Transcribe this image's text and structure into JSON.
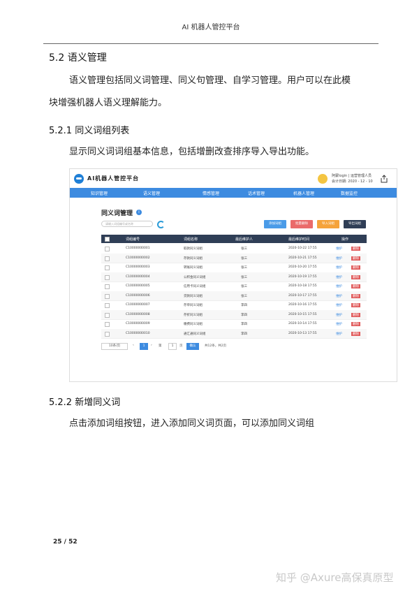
{
  "doc": {
    "header": "AI 机器人管控平台",
    "section_5_2": "5.2  语义管理",
    "para1_line1": "语义管理包括同义词管理、同义句管理、自学习管理。用户可以在此模",
    "para1_line2": "块增强机器人语义理解能力。",
    "section_5_2_1": "5.2.1  同义词组列表",
    "para2": "显示同义词词组基本信息，包括增删改查排序导入导出功能。",
    "section_5_2_2": "5.2.2  新增同义词",
    "para3": "点击添加词组按钮，进入添加同义词页面，可以添加同义词组",
    "page_number": "25 / 52",
    "watermark": "知乎 @Axure高保真原型"
  },
  "screenshot": {
    "app_title": "AI机器人管控平台",
    "user_line1": "阿蒙login | 运营管理人员",
    "user_line2": "会计日期: 2020 - 12 - 10",
    "nav": [
      "知识管理",
      "语义管理",
      "情感管理",
      "话术管理",
      "机器人管理",
      "数据监控"
    ],
    "page_title": "同义词管理",
    "search_placeholder": "请输入词组编号或名称",
    "buttons": {
      "add": "添加词组",
      "batch_delete": "批量删除",
      "import": "导入词组",
      "export": "导出词组"
    },
    "colors": {
      "add": "#4a9be8",
      "batch_delete": "#ea6a6a",
      "import": "#f5a33b",
      "export": "#2f3e56"
    },
    "columns": [
      "词组编号",
      "词组名称",
      "最后维护人",
      "最后维护时间",
      "操作"
    ],
    "rows": [
      {
        "id": "C10000000001",
        "name": "取款同义词组",
        "maintainer": "张三",
        "time": "2020-10-22 17:55",
        "edit": "维护",
        "del": "删除"
      },
      {
        "id": "C10000000002",
        "name": "存款同义词组",
        "maintainer": "张三",
        "time": "2020-10-21 17:55",
        "edit": "维护",
        "del": "删除"
      },
      {
        "id": "C10000000003",
        "name": "转账同义词组",
        "maintainer": "张三",
        "time": "2020-10-20 17:55",
        "edit": "维护",
        "del": "删除"
      },
      {
        "id": "C10000000004",
        "name": "公积金同义词组",
        "maintainer": "张三",
        "time": "2020-10-19 17:55",
        "edit": "维护",
        "del": "删除"
      },
      {
        "id": "C10000000005",
        "name": "信用卡同义词组",
        "maintainer": "张三",
        "time": "2020-10-18 17:55",
        "edit": "维护",
        "del": "删除"
      },
      {
        "id": "C10000000006",
        "name": "贷款同义词组",
        "maintainer": "张三",
        "time": "2020-10-17 17:55",
        "edit": "维护",
        "del": "删除"
      },
      {
        "id": "C10000000007",
        "name": "存单同义词组",
        "maintainer": "李四",
        "time": "2020-10-16 17:55",
        "edit": "维护",
        "del": "删除"
      },
      {
        "id": "C10000000008",
        "name": "存折同义词组",
        "maintainer": "李四",
        "time": "2020-10-15 17:55",
        "edit": "维护",
        "del": "删除"
      },
      {
        "id": "C10000000009",
        "name": "缴费同义词组",
        "maintainer": "李四",
        "time": "2020-10-14 17:55",
        "edit": "维护",
        "del": "删除"
      },
      {
        "id": "C10000000010",
        "name": "通汇通同义词组",
        "maintainer": "李四",
        "time": "2020-10-13 17:55",
        "edit": "维护",
        "del": "删除"
      }
    ],
    "pager": {
      "page_size": "10条/页",
      "current": "1",
      "goto_prefix": "第",
      "goto_value": "1",
      "goto_suffix": "页",
      "confirm": "确认",
      "total": "共12条，共2页"
    }
  }
}
